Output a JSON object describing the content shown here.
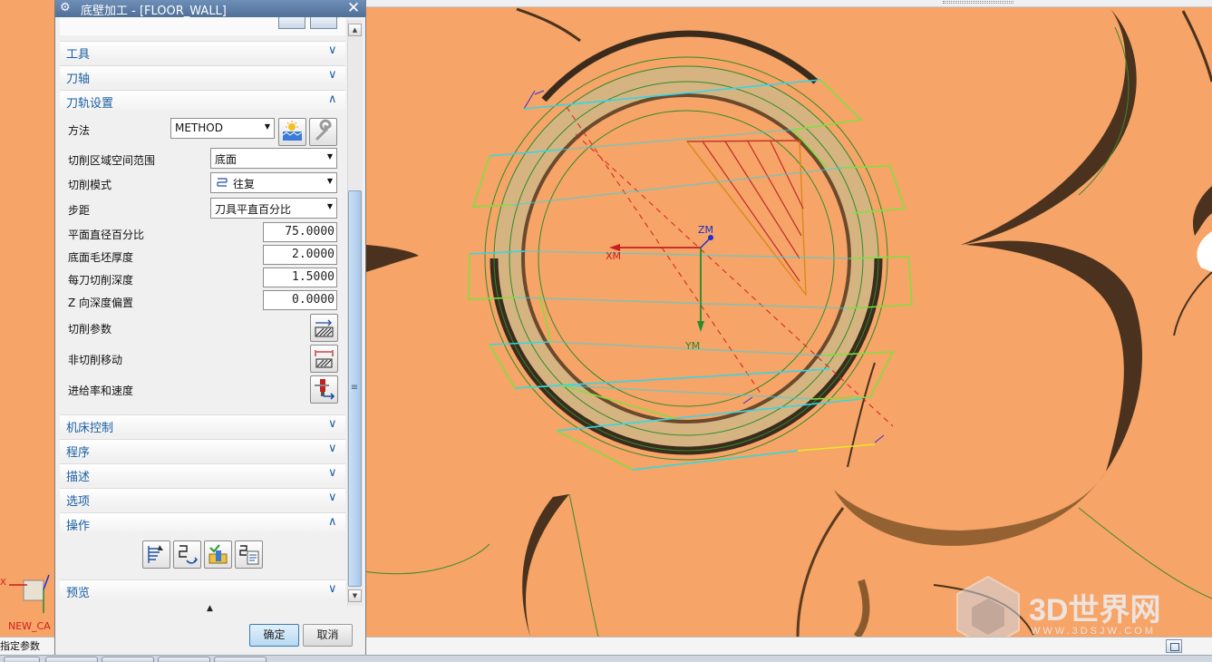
{
  "dialog": {
    "title": "底壁加工 - [FLOOR_WALL]",
    "sections": {
      "tool": "工具",
      "axis": "刀轴",
      "path_settings": "刀轨设置",
      "machine_control": "机床控制",
      "program": "程序",
      "description": "描述",
      "options": "选项",
      "actions": "操作",
      "preview": "预览"
    },
    "path_settings": {
      "method_label": "方法",
      "method_value": "METHOD",
      "cut_region_label": "切削区域空间范围",
      "cut_region_value": "底面",
      "cut_pattern_label": "切削模式",
      "cut_pattern_value": "往复",
      "stepover_label": "步距",
      "stepover_value": "刀具平直百分比",
      "flat_diameter_label": "平面直径百分比",
      "flat_diameter_value": "75.0000",
      "floor_stock_label": "底面毛坯厚度",
      "floor_stock_value": "2.0000",
      "depth_per_cut_label": "每刀切削深度",
      "depth_per_cut_value": "1.5000",
      "z_offset_label": "Z 向深度偏置",
      "z_offset_value": "0.0000",
      "cutting_params_label": "切削参数",
      "non_cutting_label": "非切削移动",
      "feeds_label": "进给率和速度"
    },
    "ok_label": "确定",
    "cancel_label": "取消"
  },
  "viewport": {
    "axis_labels": {
      "xm": "XM",
      "ym": "YM",
      "zm": "ZM"
    },
    "left_label": "NEW_CA",
    "mini_axis_x": "X"
  },
  "status_bar": {
    "text": "指定参数"
  },
  "watermark": {
    "text": "3D世界网",
    "url": "WWW.3DSJW.COM"
  },
  "colors": {
    "viewport_bg": "#f6a467",
    "part_ring": "#d6b481",
    "toolpath_cut": "#33d6e8",
    "toolpath_engage": "#7fe040",
    "toolpath_rapid": "#d42020",
    "dialog_accent": "#1b5fa3"
  }
}
